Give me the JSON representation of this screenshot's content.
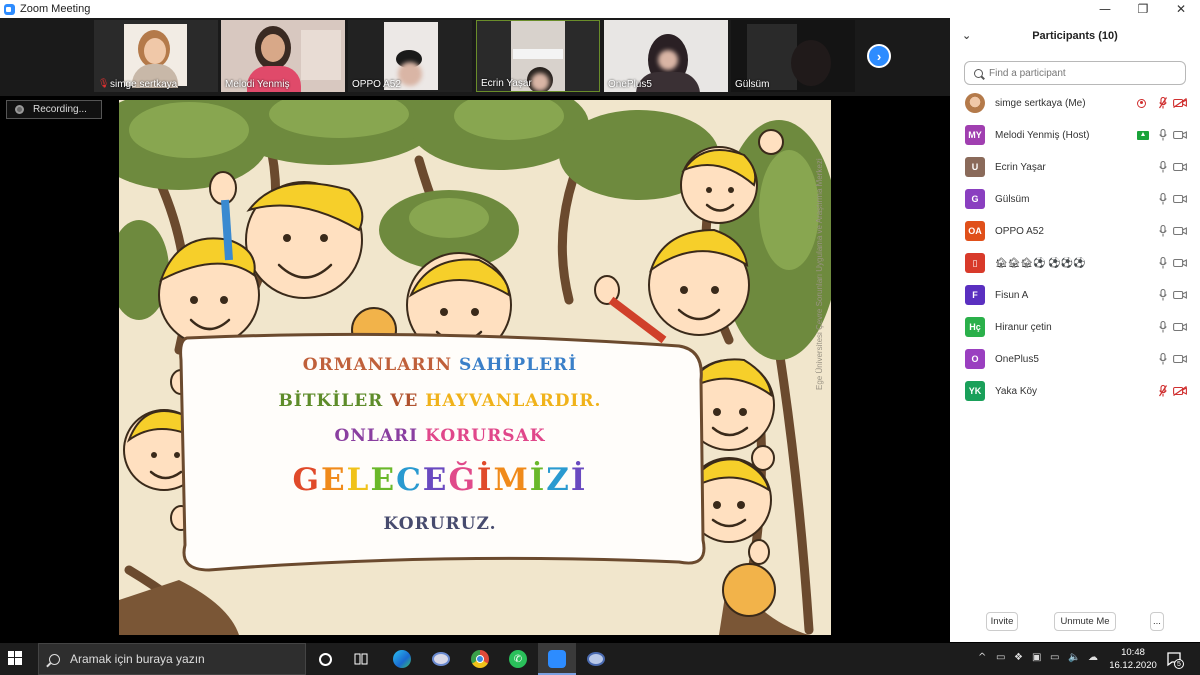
{
  "window": {
    "title": "Zoom Meeting",
    "controls": [
      "—",
      "❐",
      "✕"
    ]
  },
  "video_strip": {
    "tiles": [
      {
        "name": "simge sertkaya",
        "muted": true
      },
      {
        "name": "Melodi Yenmiş",
        "muted": false
      },
      {
        "name": "OPPO A52",
        "muted": false
      },
      {
        "name": "Ecrin Yaşar",
        "muted": false,
        "active": true
      },
      {
        "name": "OnePlus5",
        "muted": false
      },
      {
        "name": "Gülsüm",
        "muted": false
      }
    ],
    "next_icon": "chevron-right-icon"
  },
  "recording": {
    "label": "Recording..."
  },
  "slide": {
    "line1": [
      {
        "text": "ORMANLARIN ",
        "color": "#c0603a"
      },
      {
        "text": "SAHİPLERİ",
        "color": "#3a7fc8"
      }
    ],
    "line2": [
      {
        "text": "BİTKİLER ",
        "color": "#5e8c2a"
      },
      {
        "text": "VE ",
        "color": "#b0522e"
      },
      {
        "text": "HAYVANLARDIR.",
        "color": "#f0b21a"
      }
    ],
    "line3": [
      {
        "text": "ONLARI ",
        "color": "#8a3fa0"
      },
      {
        "text": "KORURSAK",
        "color": "#e0478a"
      }
    ],
    "line4": [
      {
        "text": "G",
        "color": "#e04a2a"
      },
      {
        "text": "E",
        "color": "#f08a1a"
      },
      {
        "text": "L",
        "color": "#f0c21a"
      },
      {
        "text": "E",
        "color": "#6ab82a"
      },
      {
        "text": "C",
        "color": "#2a9ad0"
      },
      {
        "text": "E",
        "color": "#6a4ac0"
      },
      {
        "text": "Ğ",
        "color": "#e04a8a"
      },
      {
        "text": "İ",
        "color": "#e04a2a"
      },
      {
        "text": "M",
        "color": "#f08a1a"
      },
      {
        "text": "İ",
        "color": "#6ab82a"
      },
      {
        "text": "Z",
        "color": "#2a9ad0"
      },
      {
        "text": "İ",
        "color": "#6a4ac0"
      }
    ],
    "line5": "KORURUZ.",
    "watermark": "Ege Üniversitesi Çevre Sorunları Uygulama ve Araştırma Merkezi"
  },
  "participants": {
    "header": "Participants (10)",
    "search_placeholder": "Find a participant",
    "list": [
      {
        "name": "simge sertkaya (Me)",
        "initials": "",
        "avatar_color": "#e8c8b0",
        "photo": true,
        "recording": true,
        "mic": "muted",
        "cam": "off"
      },
      {
        "name": "Melodi Yenmiş (Host)",
        "initials": "MY",
        "avatar_color": "#a03fb0",
        "sharing": true,
        "mic": "on",
        "cam": "on"
      },
      {
        "name": "Ecrin Yaşar",
        "initials": "U",
        "avatar_color": "#8a6a5a",
        "mic": "on",
        "cam": "on"
      },
      {
        "name": "Gülsüm",
        "initials": "G",
        "avatar_color": "#8a3fc0",
        "mic": "on",
        "cam": "on"
      },
      {
        "name": "OPPO A52",
        "initials": "OA",
        "avatar_color": "#e0501a",
        "mic": "on",
        "cam": "on"
      },
      {
        "name": "🏚🏚🏚⚽ ⚽⚽⚽",
        "initials": "▯",
        "avatar_color": "#d83a2a",
        "mic": "on",
        "cam": "on"
      },
      {
        "name": "Fisun A",
        "initials": "F",
        "avatar_color": "#5a2fc0",
        "mic": "on",
        "cam": "on"
      },
      {
        "name": "Hiranur çetin",
        "initials": "Hç",
        "avatar_color": "#2ab04a",
        "mic": "on",
        "cam": "on"
      },
      {
        "name": "OnePlus5",
        "initials": "O",
        "avatar_color": "#9a3fc0",
        "mic": "on",
        "cam": "on"
      },
      {
        "name": "Yaka Köy",
        "initials": "YK",
        "avatar_color": "#1aa05a",
        "mic": "muted",
        "cam": "off"
      }
    ],
    "footer": {
      "invite": "Invite",
      "unmute": "Unmute Me",
      "more": "..."
    }
  },
  "taskbar": {
    "search_text": "Aramak için buraya yazın",
    "time": "10:48",
    "date": "16.12.2020",
    "notifications": "5"
  }
}
